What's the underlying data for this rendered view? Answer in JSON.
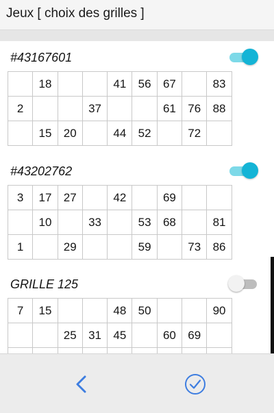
{
  "header": {
    "title": "Jeux [ choix des grilles ]"
  },
  "colors": {
    "accent": "#14b4d6",
    "track_on": "#7dd9e8",
    "nav_icon": "#3d7de0"
  },
  "grilles": [
    {
      "name": "#43167601",
      "toggle_on": true,
      "rows": [
        [
          "",
          "18",
          "",
          "",
          "41",
          "56",
          "67",
          "",
          "83"
        ],
        [
          "2",
          "",
          "",
          "37",
          "",
          "",
          "61",
          "76",
          "88"
        ],
        [
          "",
          "15",
          "20",
          "",
          "44",
          "52",
          "",
          "72",
          ""
        ]
      ]
    },
    {
      "name": "#43202762",
      "toggle_on": true,
      "rows": [
        [
          "3",
          "17",
          "27",
          "",
          "42",
          "",
          "69",
          "",
          ""
        ],
        [
          "",
          "10",
          "",
          "33",
          "",
          "53",
          "68",
          "",
          "81"
        ],
        [
          "1",
          "",
          "29",
          "",
          "",
          "59",
          "",
          "73",
          "86"
        ]
      ]
    },
    {
      "name": "GRILLE 125",
      "toggle_on": false,
      "rows": [
        [
          "7",
          "15",
          "",
          "",
          "48",
          "50",
          "",
          "",
          "90"
        ],
        [
          "",
          "",
          "25",
          "31",
          "45",
          "",
          "60",
          "69",
          ""
        ],
        [
          "",
          "",
          "",
          "",
          "",
          "",
          "",
          "",
          ""
        ]
      ]
    }
  ],
  "footer": {
    "back_icon": "chevron-left-icon",
    "confirm_icon": "check-circle-icon"
  }
}
